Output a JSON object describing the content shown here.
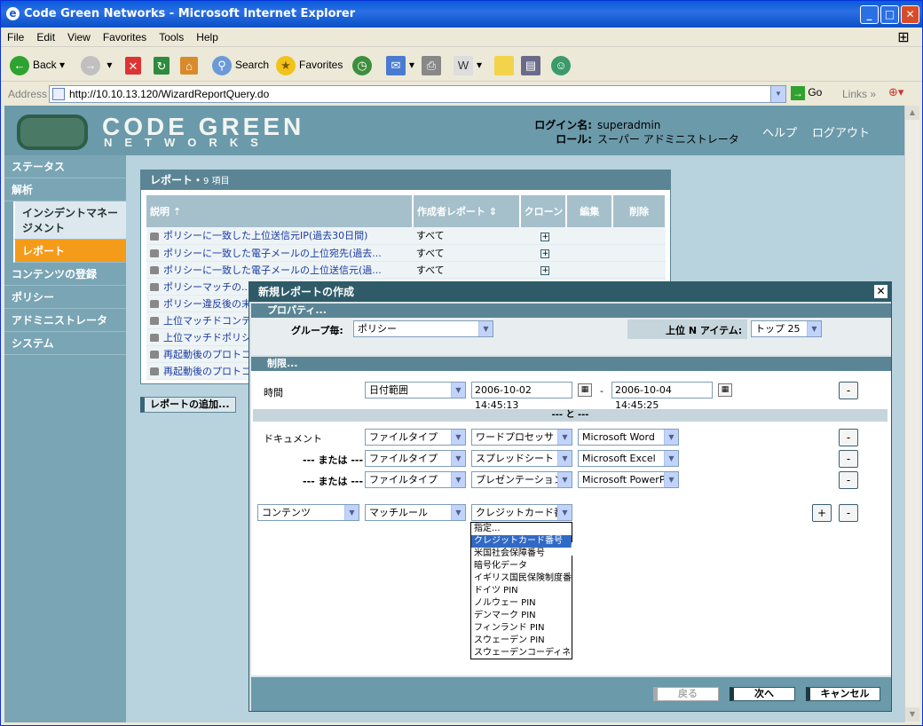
{
  "window": {
    "title": "Code Green Networks - Microsoft Internet Explorer"
  },
  "menu": [
    "File",
    "Edit",
    "View",
    "Favorites",
    "Tools",
    "Help"
  ],
  "toolbar": {
    "back": "Back",
    "search": "Search",
    "favorites": "Favorites"
  },
  "address": {
    "label": "Address",
    "url": "http://10.10.13.120/WizardReportQuery.do",
    "go": "Go",
    "links": "Links"
  },
  "brand": {
    "line1": "CODE GREEN",
    "line2": "NETWORKS"
  },
  "login": {
    "name_label": "ログイン名:",
    "name": "superadmin",
    "role_label": "ロール:",
    "role": "スーパー アドミニストレータ"
  },
  "header_links": {
    "help": "ヘルプ",
    "logout": "ログアウト"
  },
  "sidebar": [
    {
      "label": "ステータス"
    },
    {
      "label": "解析"
    },
    {
      "label": "インシデントマネージメント"
    },
    {
      "label": "レポート"
    },
    {
      "label": "コンテンツの登録"
    },
    {
      "label": "ポリシー"
    },
    {
      "label": "アドミニストレータ"
    },
    {
      "label": "システム"
    }
  ],
  "report": {
    "title": "レポート・",
    "count": "9 項目",
    "columns": [
      "説明",
      "作成者レポート",
      "クローン",
      "編集",
      "削除"
    ],
    "rows": [
      {
        "desc": "ポリシーに一致した上位送信元IP(過去30日間)",
        "author": "すべて"
      },
      {
        "desc": "ポリシーに一致した電子メールの上位宛先(過去...",
        "author": "すべて"
      },
      {
        "desc": "ポリシーに一致した電子メールの上位送信元(過...",
        "author": "すべて"
      },
      {
        "desc": "ポリシーマッチの...",
        "author": ""
      },
      {
        "desc": "ポリシー違反後の末...",
        "author": ""
      },
      {
        "desc": "上位マッチドコンテ...",
        "author": ""
      },
      {
        "desc": "上位マッチドポリシ...",
        "author": ""
      },
      {
        "desc": "再起動後のプロトコ...",
        "author": ""
      },
      {
        "desc": "再起動後のプロトコ...",
        "author": ""
      }
    ],
    "add_button": "レポートの追加..."
  },
  "dialog": {
    "title": "新規レポートの作成",
    "section_properties": "プロパティ...",
    "group_label": "グループ毎:",
    "group_value": "ポリシー",
    "top_label": "上位 N アイテム:",
    "top_value": "トップ 25",
    "section_limits": "制限...",
    "time_label": "時間",
    "time_type": "日付範囲",
    "date_from": "2006-10-02 14:45:13",
    "date_sep": "-",
    "date_to": "2006-10-04 14:45:25",
    "and_label": "--- と ---",
    "doc_label": "ドキュメント",
    "or_label": "--- または ---",
    "doc_rows": [
      {
        "type": "ファイルタイプ",
        "cat": "ワードプロセッサ",
        "app": "Microsoft Word"
      },
      {
        "type": "ファイルタイプ",
        "cat": "スプレッドシート",
        "app": "Microsoft Excel"
      },
      {
        "type": "ファイルタイプ",
        "cat": "プレゼンテーション",
        "app": "Microsoft PowerPoint"
      }
    ],
    "content": {
      "field": "コンテンツ",
      "rule": "マッチルール",
      "value": "クレジットカード番号"
    },
    "dropdown_options": [
      "指定...",
      "クレジットカード番号",
      "米国社会保障番号",
      "暗号化データ",
      "イギリス国民保険制度番号",
      "ドイツ PIN",
      "ノルウェー PIN",
      "デンマーク PIN",
      "フィンランド PIN",
      "スウェーデン PIN",
      "スウェーデンコーディネーション"
    ],
    "buttons": {
      "back": "戻る",
      "next": "次へ",
      "cancel": "キャンセル",
      "plus": "+",
      "minus": "-"
    }
  }
}
